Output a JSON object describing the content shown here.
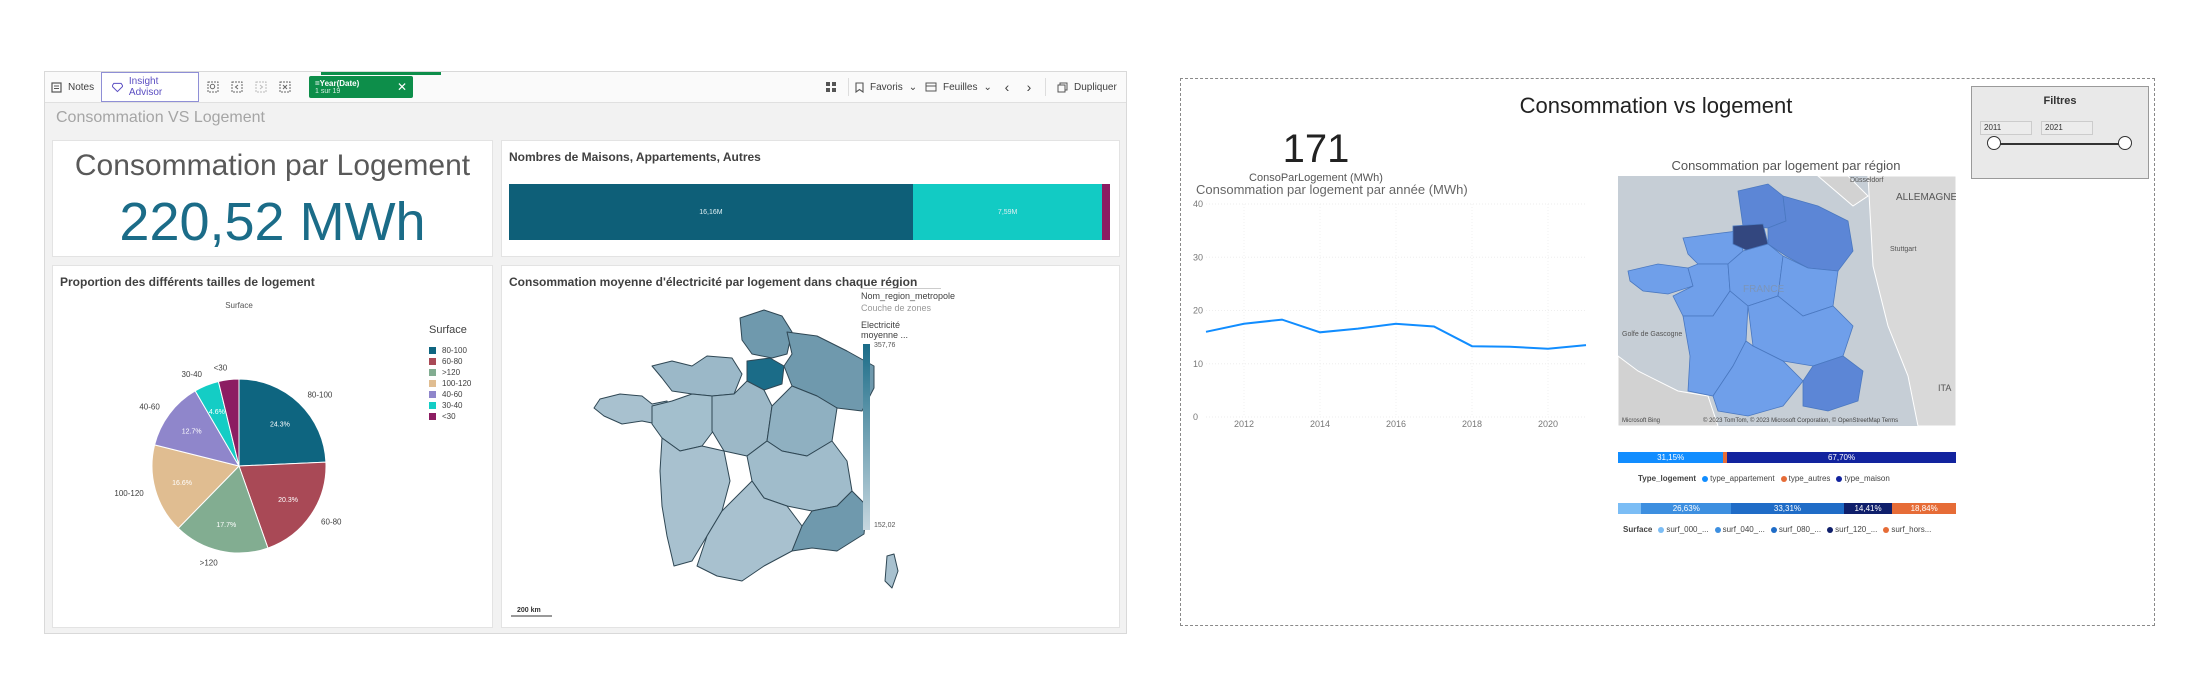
{
  "qlik": {
    "toolbar": {
      "notes": "Notes",
      "insight_advisor": "Insight Advisor",
      "selection_field": "=Year(Date)",
      "selection_value": "1 sur 19",
      "favoris": "Favoris",
      "feuilles": "Feuilles",
      "dupliquer": "Dupliquer"
    },
    "sheet_title": "Consommation VS Logement",
    "kpi": {
      "label": "Consommation par Logement",
      "value": "220,52 MWh"
    },
    "stacked_bar": {
      "title": "Nombres de Maisons, Appartements, Autres",
      "segments": [
        {
          "label": "16,16M",
          "value": 16.16,
          "color": "#0e5f78"
        },
        {
          "label": "7,59M",
          "value": 7.59,
          "color": "#12cbc4"
        },
        {
          "label": "",
          "value": 0.3,
          "color": "#8c1d62"
        }
      ]
    },
    "pie": {
      "title": "Proportion des différents tailles de logement",
      "dim_label": "Surface",
      "legend_title": "Surface",
      "legend": [
        "80-100",
        "60-80",
        ">120",
        "100-120",
        "40-60",
        "30-40",
        "<30"
      ],
      "outer_labels": [
        "80-100",
        "60-80",
        ">120",
        "100-120",
        "40-60",
        "30-40",
        "<30"
      ],
      "inner_labels": [
        "24.3%",
        "20.3%",
        "17.7%",
        "16.6%",
        "12.7%",
        "4.6%",
        ""
      ]
    },
    "map": {
      "title": "Consommation moyenne d'électricité par logement dans chaque région",
      "legend_layer": "Nom_region_metropole",
      "legend_sub": "Couche de zones",
      "legend_measure_1": "Electricité",
      "legend_measure_2": "moyenne ...",
      "legend_max": "357,76",
      "legend_min": "152,02",
      "scale": "200 km"
    }
  },
  "pbi": {
    "title": "Consommation vs logement",
    "filters": {
      "title": "Filtres",
      "start": "2011",
      "end": "2021"
    },
    "card": {
      "value": "171",
      "label": "ConsoParLogement (MWh)"
    },
    "map": {
      "title": "Consommation par logement par région",
      "labels": {
        "country": "FRANCE",
        "germany": "ALLEMAGNE",
        "gulf": "Golfe de Gascogne",
        "dusseldorf": "Düsseldorf",
        "stuttgart": "Stuttgart",
        "ita": "ITA"
      },
      "attribution": "© 2023 TomTom, © 2023 Microsoft Corporation, © OpenStreetMap  Terms",
      "brand": "Microsoft Bing"
    },
    "bar_type": {
      "legend_title": "Type_logement",
      "legend": [
        {
          "label": "type_appartement",
          "color": "#118dff"
        },
        {
          "label": "type_autres",
          "color": "#e66c37"
        },
        {
          "label": "type_maison",
          "color": "#12239e"
        }
      ],
      "segments": [
        {
          "label": "31,15%",
          "value": 31.15,
          "color": "#118dff"
        },
        {
          "label": "",
          "value": 1.15,
          "color": "#e66c37"
        },
        {
          "label": "67,70%",
          "value": 67.7,
          "color": "#12239e"
        }
      ]
    },
    "bar_surface": {
      "legend_title": "Surface",
      "legend": [
        {
          "label": "surf_000_...",
          "color": "#7bbdf5"
        },
        {
          "label": "surf_040_...",
          "color": "#3d8fe0"
        },
        {
          "label": "surf_080_...",
          "color": "#1f6cc7"
        },
        {
          "label": "surf_120_...",
          "color": "#0f1f6b"
        },
        {
          "label": "surf_hors...",
          "color": "#e66c37"
        }
      ],
      "segments": [
        {
          "label": "",
          "value": 6.9,
          "color": "#7bbdf5"
        },
        {
          "label": "26,63%",
          "value": 26.63,
          "color": "#3d8fe0"
        },
        {
          "label": "33,31%",
          "value": 33.31,
          "color": "#1f6cc7"
        },
        {
          "label": "14,41%",
          "value": 14.41,
          "color": "#0f1f6b"
        },
        {
          "label": "18,84%",
          "value": 18.84,
          "color": "#e66c37"
        }
      ]
    }
  },
  "chart_data": [
    {
      "type": "pie",
      "title": "Proportion des différents tailles de logement",
      "categories": [
        "80-100",
        "60-80",
        ">120",
        "100-120",
        "40-60",
        "30-40",
        "<30"
      ],
      "values": [
        24.3,
        20.3,
        17.7,
        16.6,
        12.7,
        4.6,
        3.8
      ],
      "colors": [
        "#0e6580",
        "#a94956",
        "#82ad91",
        "#e0bd91",
        "#8f86cb",
        "#14cdc5",
        "#8c1d62"
      ],
      "legend": "right"
    },
    {
      "type": "line",
      "title": "Consommation par logement par année (MWh)",
      "x": [
        2011,
        2012,
        2013,
        2014,
        2015,
        2016,
        2017,
        2018,
        2019,
        2020,
        2021
      ],
      "series": [
        {
          "values": [
            16.0,
            17.5,
            18.3,
            15.9,
            16.6,
            17.5,
            17.0,
            13.3,
            13.2,
            12.8,
            13.5
          ]
        }
      ],
      "xticks": [
        2012,
        2014,
        2016,
        2018,
        2020
      ],
      "yticks": [
        0,
        10,
        20,
        30,
        40
      ],
      "ylim": [
        0,
        40
      ],
      "xlim": [
        2011,
        2021
      ],
      "color": "#118dff",
      "grid": true
    }
  ]
}
